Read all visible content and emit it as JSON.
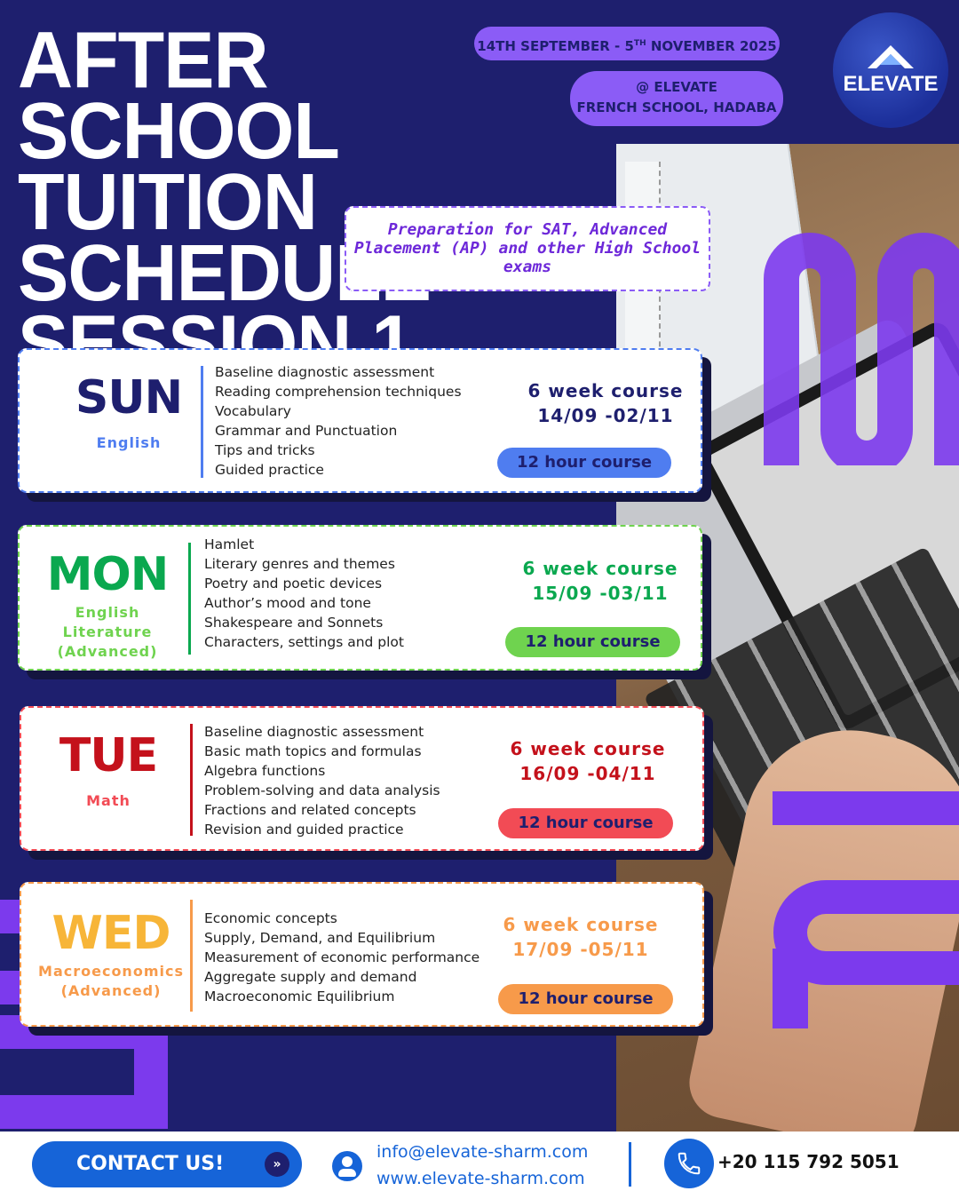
{
  "title": {
    "line1": "AFTER SCHOOL",
    "line2": "TUITION SCHEDULE",
    "line3": "SESSION 1"
  },
  "dates": {
    "start": "14TH SEPTEMBER - 5",
    "sup": "TH",
    "end": " NOVEMBER 2025"
  },
  "location": {
    "line1": "@ ELEVATE",
    "line2": "FRENCH SCHOOL, HADABA"
  },
  "logo": {
    "text": "ELEVATE",
    "icon": "mountain-icon"
  },
  "prep_text": "Preparation for SAT, Advanced Placement (AP) and other High School exams",
  "colors": {
    "background": "#1e1f6e",
    "accent_purple": "#8b5cf6",
    "footer_blue": "#1664d8"
  },
  "courses": [
    {
      "day": "SUN",
      "subject": [
        "English"
      ],
      "topics": [
        "Baseline diagnostic assessment",
        "Reading comprehension techniques",
        "Vocabulary",
        "Grammar and Punctuation",
        "Tips and tricks",
        "Guided practice"
      ],
      "weeks": "6 week course",
      "range": "14/09 -02/11",
      "hours": "12 hour course",
      "day_color": "#1e1f6e",
      "accent": "#4f7df0",
      "subject_color": "#4f7df0",
      "course_color": "#1e1f6e"
    },
    {
      "day": "MON",
      "subject": [
        "English",
        "Literature",
        "(Advanced)"
      ],
      "topics": [
        "Hamlet",
        "Literary genres and themes",
        "Poetry and poetic devices",
        "Author’s mood and tone",
        "Shakespeare and Sonnets",
        "Characters, settings and plot"
      ],
      "weeks": "6 week course",
      "range": "15/09 -03/11",
      "hours": "12 hour course",
      "day_color": "#0aa84f",
      "accent": "#6fd34f",
      "subject_color": "#6fd34f",
      "course_color": "#0aa84f"
    },
    {
      "day": "TUE",
      "subject": [
        "Math"
      ],
      "topics": [
        "Baseline diagnostic assessment",
        "Basic math topics and formulas",
        "Algebra functions",
        "Problem-solving and data analysis",
        "Fractions and related concepts",
        "Revision and guided practice"
      ],
      "weeks": "6 week course",
      "range": "16/09 -04/11",
      "hours": "12 hour course",
      "day_color": "#c4111b",
      "accent": "#f24b55",
      "subject_color": "#f24b55",
      "course_color": "#c4111b"
    },
    {
      "day": "WED",
      "subject": [
        "Macroeconomics",
        "(Advanced)"
      ],
      "topics": [
        "Economic concepts",
        "Supply, Demand, and Equilibrium",
        "Measurement of economic performance",
        "Aggregate supply and demand",
        "Macroeconomic Equilibrium"
      ],
      "weeks": "6 week course",
      "range": "17/09 -05/11",
      "hours": "12 hour course",
      "day_color": "#f7b538",
      "accent": "#f79a4a",
      "subject_color": "#f79a4a",
      "course_color": "#f79a4a"
    }
  ],
  "footer": {
    "contact_label": "CONTACT US!",
    "contact_icon": "double-chevron-right-icon",
    "email": "info@elevate-sharm.com",
    "website": "www.elevate-sharm.com",
    "phone": "+20 115 792 5051",
    "person_icon": "person-icon",
    "phone_icon": "phone-icon"
  }
}
